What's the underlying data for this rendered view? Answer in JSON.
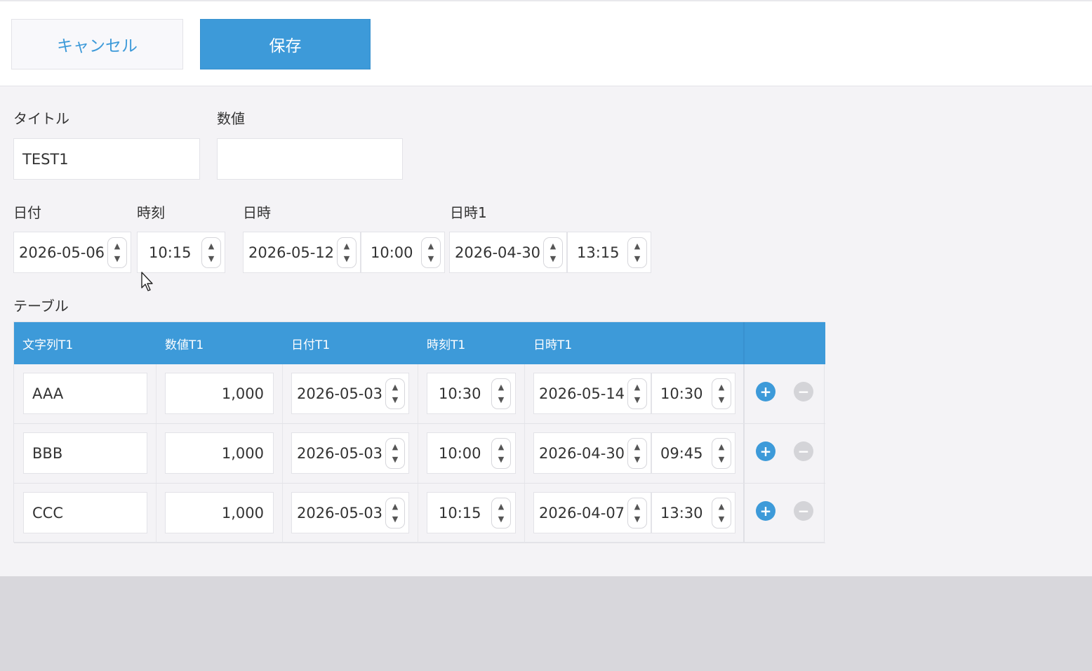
{
  "toolbar": {
    "cancel_label": "キャンセル",
    "save_label": "保存"
  },
  "form": {
    "title_label": "タイトル",
    "title_value": "TEST1",
    "number_label": "数値",
    "number_value": "",
    "date_label": "日付",
    "date_value": "2026-05-06",
    "time_label": "時刻",
    "time_value": "10:15",
    "datetime_label": "日時",
    "datetime_date": "2026-05-12",
    "datetime_time": "10:00",
    "datetime1_label": "日時1",
    "datetime1_date": "2026-04-30",
    "datetime1_time": "13:15"
  },
  "table": {
    "label": "テーブル",
    "headers": [
      "文字列T1",
      "数値T1",
      "日付T1",
      "時刻T1",
      "日時T1"
    ],
    "rows": [
      {
        "text": "AAA",
        "number": "1,000",
        "date": "2026-05-03",
        "time": "10:30",
        "dt_date": "2026-05-14",
        "dt_time": "10:30"
      },
      {
        "text": "BBB",
        "number": "1,000",
        "date": "2026-05-03",
        "time": "10:00",
        "dt_date": "2026-04-30",
        "dt_time": "09:45"
      },
      {
        "text": "CCC",
        "number": "1,000",
        "date": "2026-05-03",
        "time": "10:15",
        "dt_date": "2026-04-07",
        "dt_time": "13:30"
      }
    ]
  },
  "icons": {
    "spin_up": "▲",
    "spin_down": "▼",
    "add_row": "+",
    "remove_row": "−"
  },
  "colors": {
    "accent": "#3d9ad9",
    "disabled": "#d4d4d8"
  }
}
